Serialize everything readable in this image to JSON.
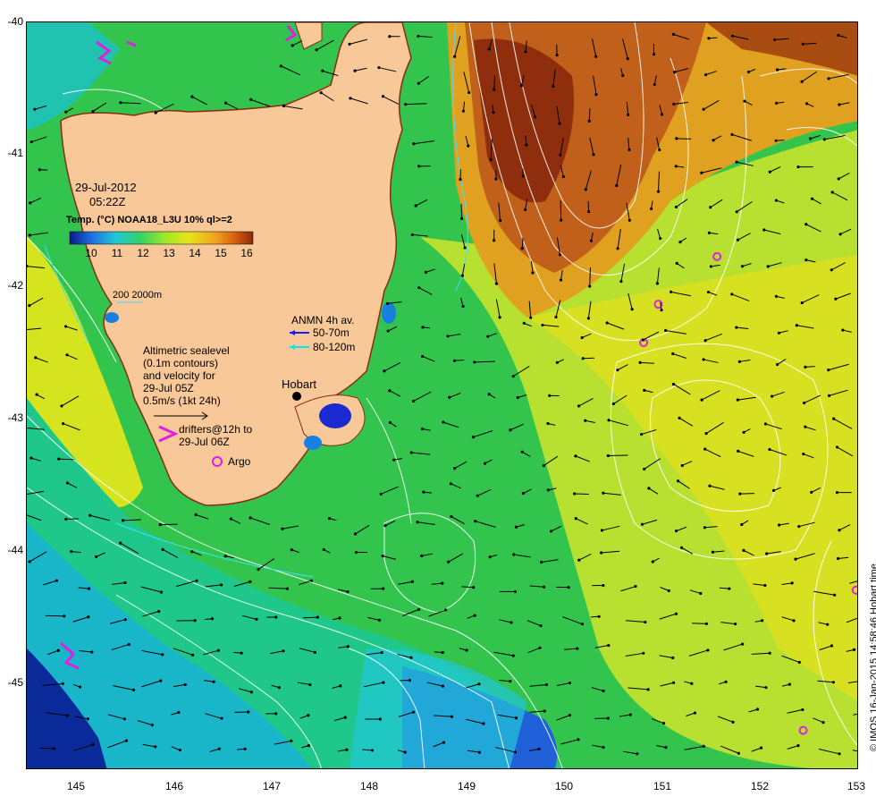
{
  "map": {
    "date": "29-Jul-2012",
    "time": "05:22Z",
    "product": "Temp. (°C) NOAA18_L3U 10% ql>=2",
    "colorbar_ticks": [
      "10",
      "11",
      "12",
      "13",
      "14",
      "15",
      "16"
    ],
    "colorbar_colors": [
      "#0a1a8a",
      "#1f6fe0",
      "#22c6d8",
      "#2fd26a",
      "#9ee82a",
      "#e8e418",
      "#f0a020",
      "#d86010",
      "#8a2a0a"
    ],
    "depth_legend": "200  2000m",
    "anmn_title": "ANMN 4h av.",
    "anmn_50_70": "50-70m",
    "anmn_80_120": "80-120m",
    "altimetry_lines": [
      "Altimetric sealevel",
      "(0.1m contours)",
      "and velocity for",
      "29-Jul 05Z",
      "0.5m/s (1kt 24h)"
    ],
    "drifters_lines": [
      "drifters@12h to",
      "29-Jul 06Z"
    ],
    "argo_label": "Argo",
    "hobart_label": "Hobart",
    "credit": "© IMOS 16-Jan-2015 14:58:46 Hobart time",
    "lat_ticks": [
      "-40",
      "-41",
      "-42",
      "-43",
      "-44",
      "-45"
    ],
    "lon_ticks": [
      "145",
      "146",
      "147",
      "148",
      "149",
      "150",
      "151",
      "152",
      "153"
    ],
    "colors": {
      "land": "#f8c898",
      "coast": "#8b2a10",
      "cool_water": "#2fc25a",
      "warm_water": "#c8641e",
      "cold_water": "#0a2a9a",
      "contour": "#ffffff",
      "arrow": "#000000",
      "argo": "#e020e0",
      "anmn_blue": "#1a1aff",
      "anmn_cyan": "#00e8ff"
    },
    "argo_floats": [
      {
        "lon": 151.55,
        "lat": -41.77
      },
      {
        "lon": 150.95,
        "lat": -42.13
      },
      {
        "lon": 150.8,
        "lat": -42.42
      },
      {
        "lon": 152.43,
        "lat": -45.35
      },
      {
        "lon": 152.97,
        "lat": -44.29
      }
    ]
  }
}
